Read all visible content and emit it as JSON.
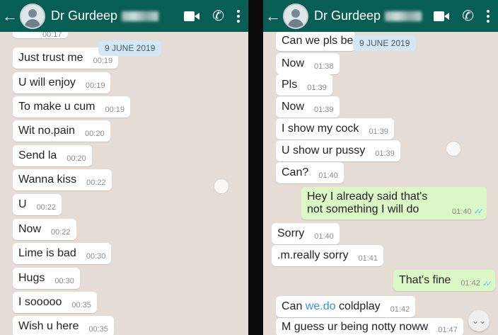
{
  "left": {
    "appbar": {
      "back": "←",
      "contact": "Dr Gurdeep",
      "phone_glyph": "✆"
    },
    "date_chip": "9 JUNE 2019",
    "messages": [
      {
        "text": "",
        "time": "00:17"
      },
      {
        "text": "Just trust me",
        "time": "00:19"
      },
      {
        "text": "U will enjoy",
        "time": "00:19"
      },
      {
        "text": "To make u cum",
        "time": "00:19"
      },
      {
        "text": "Wit no.pain",
        "time": "00:20"
      },
      {
        "text": "Send la",
        "time": "00:20"
      },
      {
        "text": "Wanna kiss",
        "time": "00:22"
      },
      {
        "text": "U",
        "time": "00:22"
      },
      {
        "text": "Now",
        "time": "00:22"
      },
      {
        "text": "Lime is bad",
        "time": "00:30"
      },
      {
        "text": "Hugs",
        "time": "00:30"
      },
      {
        "text": "I sooooo",
        "time": "00:35"
      },
      {
        "text": "Wish u here",
        "time": "00:35"
      }
    ]
  },
  "right": {
    "appbar": {
      "back": "←",
      "contact": "Dr Gurdeep",
      "phone_glyph": "✆"
    },
    "date_chip": "9 JUNE 2019",
    "messages": [
      {
        "text": "Can we pls be h",
        "time": ""
      },
      {
        "text": "Now",
        "time": "01:38"
      },
      {
        "text": "Pls",
        "time": "01:39"
      },
      {
        "text": "Now",
        "time": "01:39"
      },
      {
        "text": "I show my cock",
        "time": "01:39"
      },
      {
        "text": "U show ur pussy",
        "time": "01:39"
      },
      {
        "text": "Can?",
        "time": "01:40"
      },
      {
        "text": "Hey I already said that's not something I will do",
        "time": "01:40",
        "ticks": "✓✓"
      },
      {
        "text": "Sorry",
        "time": "01:40"
      },
      {
        "text": ".m.really sorry",
        "time": "01:41"
      },
      {
        "text": "That's fine",
        "time": "01:42",
        "ticks": "✓✓"
      },
      {
        "text_before": "Can ",
        "link": "we.do",
        "text_after": " coldplay",
        "time": "01:42"
      },
      {
        "text": "M guess ur being notty noww",
        "time": "01:47"
      }
    ],
    "scroll_glyph": "⌄⌄"
  },
  "colors": {
    "header": "#075e54",
    "chat_bg": "#e5ddd5",
    "outgoing": "#dcf8c6",
    "incoming": "#ffffff",
    "read_ticks": "#4fc3f7",
    "date_chip": "#d4e8f4"
  }
}
